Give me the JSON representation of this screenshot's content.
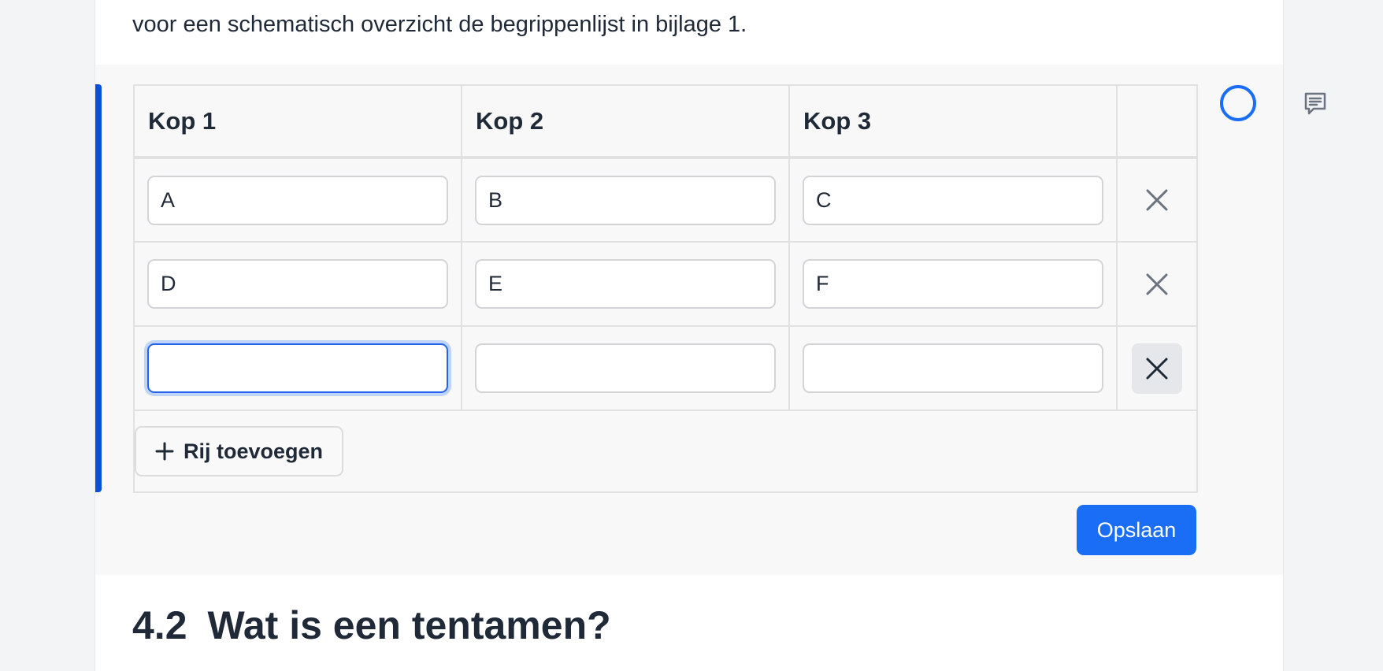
{
  "document": {
    "intro_text": "voor een schematisch overzicht de begrippenlijst in bijlage 1."
  },
  "table": {
    "headers": [
      "Kop 1",
      "Kop 2",
      "Kop 3"
    ],
    "rows": [
      [
        "A",
        "B",
        "C"
      ],
      [
        "D",
        "E",
        "F"
      ],
      [
        "",
        "",
        ""
      ]
    ],
    "focused_cell": "row 3, column 1",
    "add_row_label": "Rij toevoegen"
  },
  "actions": {
    "save_label": "Opslaan"
  },
  "section": {
    "number": "4.2",
    "title": "Wat is een tentamen?"
  },
  "icons": {
    "delete": "close-icon",
    "add": "plus-icon",
    "comment": "comment-icon",
    "status": "status-circle-icon"
  },
  "colors": {
    "accent": "#1a6ef5",
    "active_bar": "#0b4fd9",
    "text": "#1f2937",
    "block_background": "#f8f8f8"
  }
}
